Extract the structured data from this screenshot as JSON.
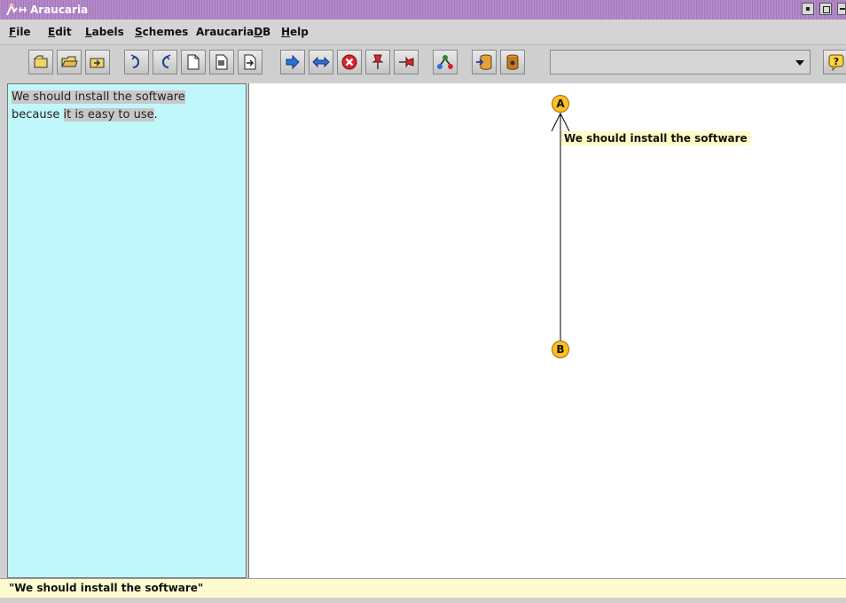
{
  "window": {
    "title": "Araucaria",
    "title_icon": "araucaria-app-icon",
    "controls": [
      "minimize-icon",
      "maximize-icon",
      "close-icon"
    ]
  },
  "menu": {
    "items": [
      {
        "label": "File",
        "underline": "F"
      },
      {
        "label": "Edit",
        "underline": "E"
      },
      {
        "label": "Labels",
        "underline": "L"
      },
      {
        "label": "Schemes",
        "underline": "S"
      },
      {
        "label": "AraucariaDB",
        "underline": "D"
      },
      {
        "label": "Help",
        "underline": "H"
      }
    ]
  },
  "toolbar": {
    "buttons": [
      {
        "icon": "open-file-icon"
      },
      {
        "icon": "open-folder-icon"
      },
      {
        "icon": "import-icon"
      },
      {
        "icon": "undo-icon"
      },
      {
        "icon": "redo-icon"
      },
      {
        "icon": "new-document-icon"
      },
      {
        "icon": "document-text-icon"
      },
      {
        "icon": "export-icon"
      },
      {
        "icon": "link-arrow-icon"
      },
      {
        "icon": "swap-arrows-icon"
      },
      {
        "icon": "delete-icon"
      },
      {
        "icon": "pin-icon"
      },
      {
        "icon": "unpin-icon"
      },
      {
        "icon": "tree-icon"
      },
      {
        "icon": "database-save-icon"
      },
      {
        "icon": "database-icon"
      }
    ],
    "combo_value": "",
    "help_icon": "help-icon"
  },
  "text_panel": {
    "line1": "We should install the software",
    "line2_prefix": "because ",
    "line2_highlight": "it is easy to use",
    "line2_suffix": ".",
    "background": "#bff7fa"
  },
  "diagram": {
    "nodes": [
      {
        "id": "A",
        "label": "We should install the software"
      },
      {
        "id": "B"
      }
    ],
    "edge": {
      "from": "B",
      "to": "A"
    },
    "node_color": "#ffbf1f",
    "label_bg": "#fffbc4"
  },
  "status": {
    "text": "\"We should install the software\""
  }
}
